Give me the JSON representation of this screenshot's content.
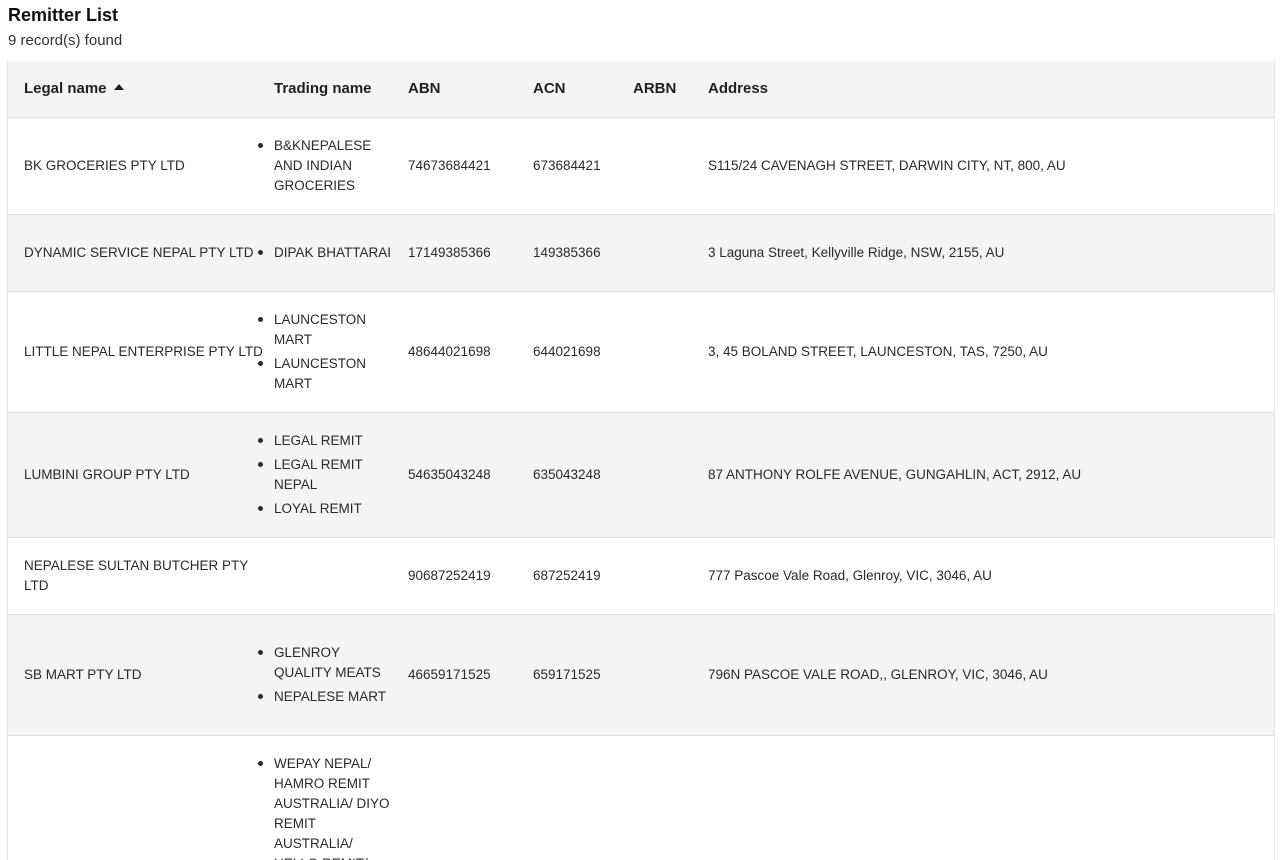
{
  "page": {
    "title": "Remitter List",
    "record_count": "9 record(s) found"
  },
  "table": {
    "columns": [
      "Legal name",
      "Trading name",
      "ABN",
      "ACN",
      "ARBN",
      "Address"
    ],
    "sort": {
      "column": "Legal name",
      "direction": "ascending",
      "icon": "sort-ascending-icon"
    },
    "rows": [
      {
        "legal_name": "BK GROCERIES PTY LTD",
        "trading_names": [
          "B&KNEPALESE AND INDIAN GROCERIES"
        ],
        "abn": "74673684421",
        "acn": "673684421",
        "arbn": "",
        "address": "S115/24 CAVENAGH STREET, DARWIN CITY, NT, 800, AU"
      },
      {
        "legal_name": "DYNAMIC SERVICE NEPAL PTY LTD",
        "trading_names": [
          "DIPAK BHATTARAI"
        ],
        "abn": "17149385366",
        "acn": "149385366",
        "arbn": "",
        "address": "3 Laguna Street, Kellyville Ridge, NSW, 2155, AU"
      },
      {
        "legal_name": "LITTLE NEPAL ENTERPRISE PTY LTD",
        "trading_names": [
          "LAUNCESTON MART",
          "LAUNCESTON MART"
        ],
        "abn": "48644021698",
        "acn": "644021698",
        "arbn": "",
        "address": "3, 45 BOLAND STREET, LAUNCESTON, TAS, 7250, AU"
      },
      {
        "legal_name": "LUMBINI GROUP PTY LTD",
        "trading_names": [
          "LEGAL REMIT",
          "LEGAL REMIT NEPAL",
          "LOYAL REMIT"
        ],
        "abn": "54635043248",
        "acn": "635043248",
        "arbn": "",
        "address": "87 ANTHONY ROLFE AVENUE, GUNGAHLIN, ACT, 2912, AU"
      },
      {
        "legal_name": "NEPALESE SULTAN BUTCHER PTY LTD",
        "trading_names": [],
        "abn": "90687252419",
        "acn": "687252419",
        "arbn": "",
        "address": "777 Pascoe Vale Road, Glenroy, VIC, 3046, AU"
      },
      {
        "legal_name": "SB MART PTY LTD",
        "trading_names": [
          "GLENROY QUALITY MEATS",
          "NEPALESE MART"
        ],
        "abn": "46659171525",
        "acn": "659171525",
        "arbn": "",
        "address": "796N PASCOE VALE ROAD,, GLENROY, VIC, 3046, AU"
      },
      {
        "legal_name": "",
        "trading_names": [
          "WEPAY NEPAL/ HAMRO REMIT AUSTRALIA/ DIYO REMIT AUSTRALIA/ HELLO REMIT/"
        ],
        "abn": "",
        "acn": "",
        "arbn": "",
        "address": ""
      }
    ]
  },
  "colors": {
    "header_bg": "#f3f4f5",
    "alt_row_bg": "#f3f4f5",
    "border": "#dfe2e5",
    "text": "#1f1f1f"
  }
}
